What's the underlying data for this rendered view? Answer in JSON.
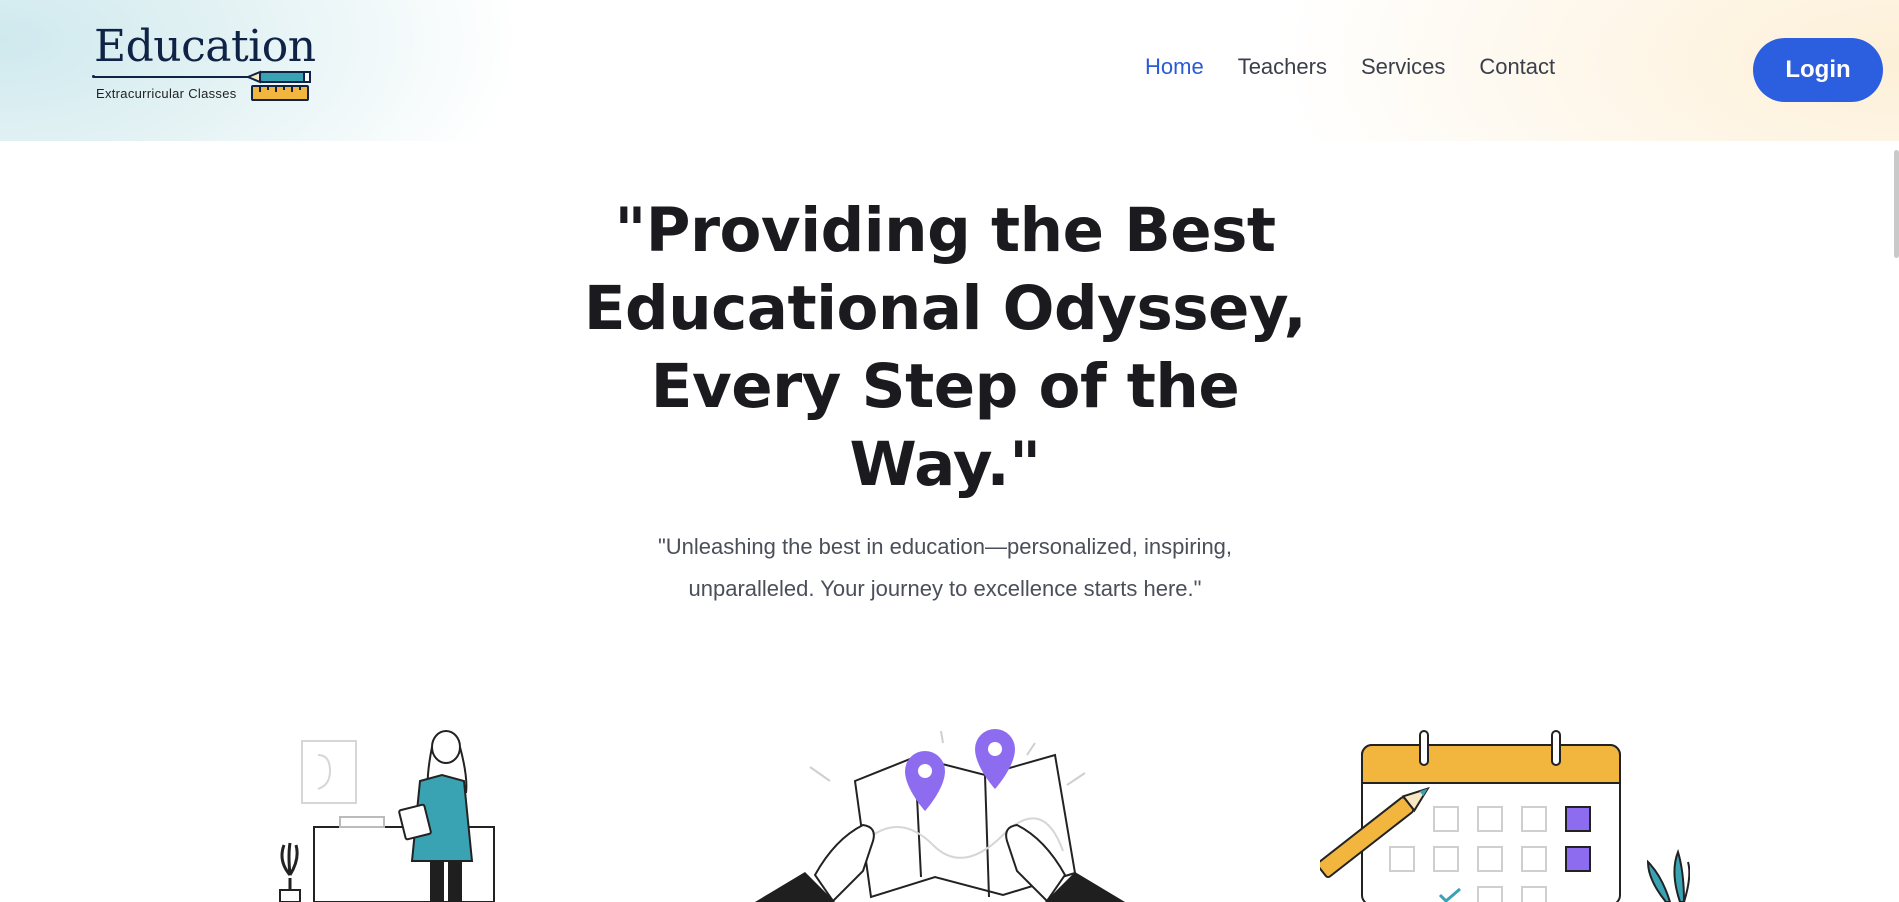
{
  "brand": {
    "title": "Education",
    "subtitle": "Extracurricular Classes"
  },
  "nav": {
    "items": [
      {
        "label": "Home",
        "active": true
      },
      {
        "label": "Teachers",
        "active": false
      },
      {
        "label": "Services",
        "active": false
      },
      {
        "label": "Contact",
        "active": false
      }
    ]
  },
  "header": {
    "login_label": "Login"
  },
  "hero": {
    "title": "\"Providing the Best Educational Odyssey, Every Step of the Way.\"",
    "subtitle": "\"Unleashing the best in education—personalized, inspiring, unparalleled. Your journey to excellence starts here.\""
  },
  "colors": {
    "accent": "#2c5fe0",
    "nav_active": "#2a5bd7",
    "teal": "#3aa3b3",
    "purple": "#8e6cf0",
    "yellow": "#f2b63f"
  },
  "illustrations": [
    "teacher-illustration",
    "map-illustration",
    "calendar-illustration"
  ]
}
